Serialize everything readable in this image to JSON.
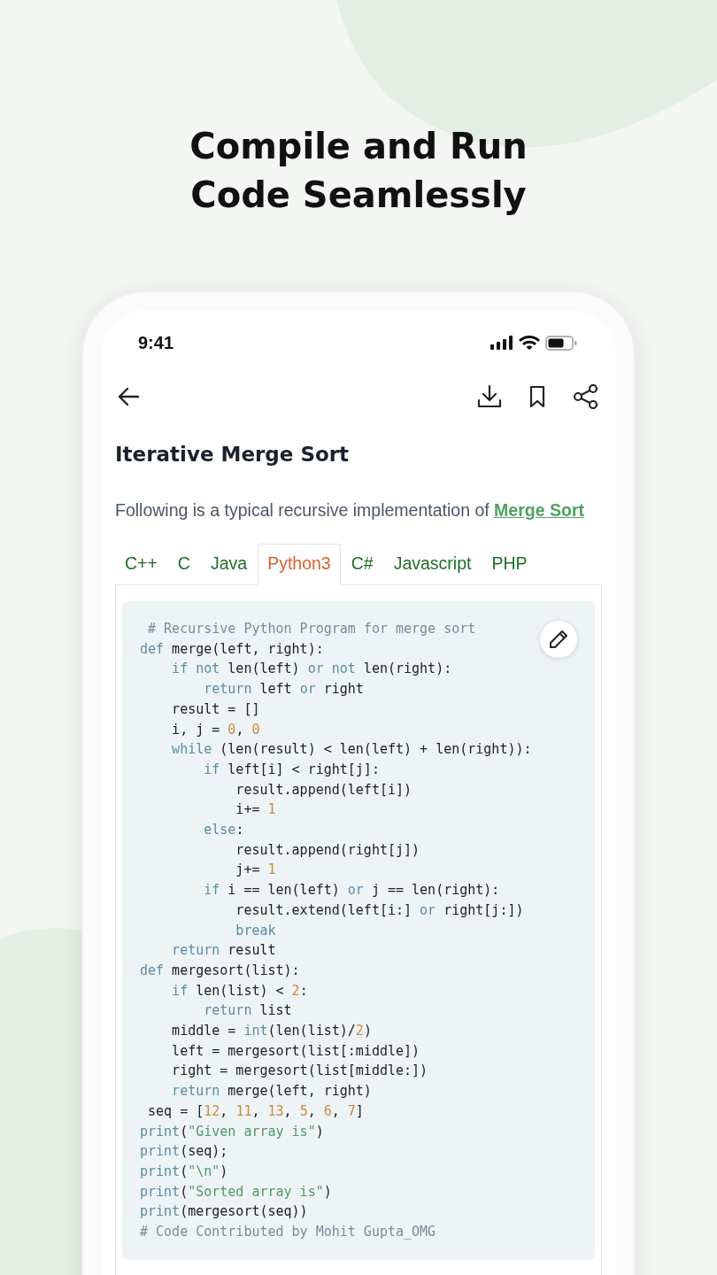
{
  "headline": [
    "Compile and Run",
    "Code Seamlessly"
  ],
  "status_bar": {
    "time": "9:41"
  },
  "article": {
    "title": "Iterative Merge Sort",
    "intro": "Following is a typical recursive implementation of ",
    "intro_link": "Merge Sort"
  },
  "tabs": [
    {
      "label": "C++",
      "selected": false
    },
    {
      "label": "C",
      "selected": false
    },
    {
      "label": "Java",
      "selected": false
    },
    {
      "label": "Python3",
      "selected": true
    },
    {
      "label": "C#",
      "selected": false
    },
    {
      "label": "Javascript",
      "selected": false
    },
    {
      "label": "PHP",
      "selected": false
    }
  ],
  "code_lines": [
    [
      {
        "kind": "comment",
        "text": " # Recursive Python Program for merge sort"
      }
    ],
    [
      {
        "kind": "keyword",
        "text": "def"
      },
      {
        "kind": "plain",
        "text": " merge(left, right):"
      }
    ],
    [
      {
        "kind": "keyword",
        "text": "    if not"
      },
      {
        "kind": "plain",
        "text": " len(left) "
      },
      {
        "kind": "keyword",
        "text": "or not"
      },
      {
        "kind": "plain",
        "text": " len(right):"
      }
    ],
    [
      {
        "kind": "keyword",
        "text": "        return"
      },
      {
        "kind": "plain",
        "text": " left "
      },
      {
        "kind": "keyword",
        "text": "or"
      },
      {
        "kind": "plain",
        "text": " right"
      }
    ],
    [
      {
        "kind": "plain",
        "text": "    result = []"
      }
    ],
    [
      {
        "kind": "plain",
        "text": "    i, j = "
      },
      {
        "kind": "number",
        "text": "0"
      },
      {
        "kind": "plain",
        "text": ", "
      },
      {
        "kind": "number",
        "text": "0"
      }
    ],
    [
      {
        "kind": "keyword",
        "text": "    while"
      },
      {
        "kind": "plain",
        "text": " (len(result) < len(left) + len(right)):"
      }
    ],
    [
      {
        "kind": "keyword",
        "text": "        if"
      },
      {
        "kind": "plain",
        "text": " left[i] < right[j]:"
      }
    ],
    [
      {
        "kind": "plain",
        "text": "            result.append(left[i])"
      }
    ],
    [
      {
        "kind": "plain",
        "text": "            i+= "
      },
      {
        "kind": "number",
        "text": "1"
      }
    ],
    [
      {
        "kind": "keyword",
        "text": "        else"
      },
      {
        "kind": "plain",
        "text": ":"
      }
    ],
    [
      {
        "kind": "plain",
        "text": "            result.append(right[j])"
      }
    ],
    [
      {
        "kind": "plain",
        "text": "            j+= "
      },
      {
        "kind": "number",
        "text": "1"
      }
    ],
    [
      {
        "kind": "keyword",
        "text": "        if"
      },
      {
        "kind": "plain",
        "text": " i == len(left) "
      },
      {
        "kind": "keyword",
        "text": "or"
      },
      {
        "kind": "plain",
        "text": " j == len(right):"
      }
    ],
    [
      {
        "kind": "plain",
        "text": "            result.extend(left[i:] "
      },
      {
        "kind": "keyword",
        "text": "or"
      },
      {
        "kind": "plain",
        "text": " right[j:])"
      }
    ],
    [
      {
        "kind": "keyword",
        "text": "            break"
      }
    ],
    [
      {
        "kind": "keyword",
        "text": "    return"
      },
      {
        "kind": "plain",
        "text": " result"
      }
    ],
    [
      {
        "kind": "keyword",
        "text": "def"
      },
      {
        "kind": "plain",
        "text": " mergesort(list):"
      }
    ],
    [
      {
        "kind": "keyword",
        "text": "    if"
      },
      {
        "kind": "plain",
        "text": " len(list) < "
      },
      {
        "kind": "number",
        "text": "2"
      },
      {
        "kind": "plain",
        "text": ":"
      }
    ],
    [
      {
        "kind": "keyword",
        "text": "        return"
      },
      {
        "kind": "plain",
        "text": " list"
      }
    ],
    [
      {
        "kind": "plain",
        "text": "    middle = "
      },
      {
        "kind": "keyword",
        "text": "int"
      },
      {
        "kind": "plain",
        "text": "(len(list)/"
      },
      {
        "kind": "number",
        "text": "2"
      },
      {
        "kind": "plain",
        "text": ")"
      }
    ],
    [
      {
        "kind": "plain",
        "text": "    left = mergesort(list[:middle])"
      }
    ],
    [
      {
        "kind": "plain",
        "text": "    right = mergesort(list[middle:])"
      }
    ],
    [
      {
        "kind": "keyword",
        "text": "    return"
      },
      {
        "kind": "plain",
        "text": " merge(left, right)"
      }
    ],
    [
      {
        "kind": "plain",
        "text": " seq = ["
      },
      {
        "kind": "number",
        "text": "12"
      },
      {
        "kind": "plain",
        "text": ", "
      },
      {
        "kind": "number",
        "text": "11"
      },
      {
        "kind": "plain",
        "text": ", "
      },
      {
        "kind": "number",
        "text": "13"
      },
      {
        "kind": "plain",
        "text": ", "
      },
      {
        "kind": "number",
        "text": "5"
      },
      {
        "kind": "plain",
        "text": ", "
      },
      {
        "kind": "number",
        "text": "6"
      },
      {
        "kind": "plain",
        "text": ", "
      },
      {
        "kind": "number",
        "text": "7"
      },
      {
        "kind": "plain",
        "text": "]"
      }
    ],
    [
      {
        "kind": "keyword",
        "text": "print"
      },
      {
        "kind": "plain",
        "text": "("
      },
      {
        "kind": "string",
        "text": "\"Given array is\""
      },
      {
        "kind": "plain",
        "text": ")"
      }
    ],
    [
      {
        "kind": "keyword",
        "text": "print"
      },
      {
        "kind": "plain",
        "text": "(seq);"
      }
    ],
    [
      {
        "kind": "keyword",
        "text": "print"
      },
      {
        "kind": "plain",
        "text": "("
      },
      {
        "kind": "string",
        "text": "\"\\n\""
      },
      {
        "kind": "plain",
        "text": ")"
      }
    ],
    [
      {
        "kind": "keyword",
        "text": "print"
      },
      {
        "kind": "plain",
        "text": "("
      },
      {
        "kind": "string",
        "text": "\"Sorted array is\""
      },
      {
        "kind": "plain",
        "text": ")"
      }
    ],
    [
      {
        "kind": "keyword",
        "text": "print"
      },
      {
        "kind": "plain",
        "text": "(mergesort(seq))"
      }
    ],
    [
      {
        "kind": "comment",
        "text": "# Code Contributed by Mohit Gupta_OMG"
      }
    ]
  ]
}
